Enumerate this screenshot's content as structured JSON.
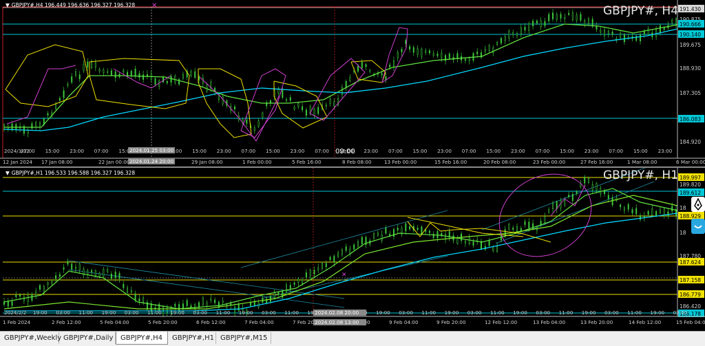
{
  "top_chart": {
    "info": "GBPJPY#,H4  196.449 196.636 196.327 196.328",
    "title": "GBPJPY#, H4",
    "price_labels": [
      {
        "text": "191.430",
        "color": "#d8d8d8",
        "tc": "#000"
      },
      {
        "text": "190.875",
        "color": "none",
        "tc": "#cfcfcf"
      },
      {
        "text": "190.666",
        "color": "#00c8d8",
        "tc": "#000"
      },
      {
        "text": "190.140",
        "color": "#00c8d8",
        "tc": "#000"
      },
      {
        "text": "189.675",
        "color": "none",
        "tc": "#cfcfcf"
      },
      {
        "text": "188.930",
        "color": "none",
        "tc": "#cfcfcf"
      },
      {
        "text": "187.305",
        "color": "none",
        "tc": "#cfcfcf"
      },
      {
        "text": "186.083",
        "color": "#00c8d8",
        "tc": "#000"
      },
      {
        "text": "184.920",
        "color": "none",
        "tc": "#cfcfcf"
      }
    ],
    "time_labels": [
      "12 Jan 2024",
      "17 Jan 08:00",
      "22 Jan 00:00",
      "29 Jan 08:00",
      "1 Feb 00:00",
      "5 Feb 16:00",
      "8 Feb 08:00",
      "13 Feb 00:00",
      "15 Feb 16:00",
      "20 Feb 08:00",
      "23 Feb 00:00",
      "27 Feb 16:00",
      "1 Mar 08:00",
      "6 Mar 00:00"
    ],
    "session_labels": [
      "07:00",
      "15:00",
      "23:00",
      "07:00",
      "15:00",
      "23:00",
      "07:00",
      "15:00",
      "23:00",
      "07:00",
      "15:00",
      "23:00",
      "07:00",
      "15:00",
      "23:00",
      "07:00",
      "15:00",
      "23:00",
      "07:00",
      "15:00",
      "23:00",
      "07:00",
      "15:00",
      "23:00",
      "07:00",
      "15:00",
      "23:00"
    ],
    "chart_start_label": "2024/1/12",
    "crosshair_time_top": "2024.01.25 03:00",
    "crosshair_time_bottom": "2024.01.24 20:00",
    "cursor_time": "09:00"
  },
  "bottom_chart": {
    "info": "GBPJPY#,H1  196.533 196.588 196.327 196.328",
    "title": "GBPJPY#, H1",
    "price_labels": [
      {
        "text": "189.997",
        "color": "#f0e000",
        "tc": "#000"
      },
      {
        "text": "189.820",
        "color": "none",
        "tc": "#cfcfcf"
      },
      {
        "text": "189.612",
        "color": "#00c8d8",
        "tc": "#000"
      },
      {
        "text": "18",
        "color": "none",
        "tc": "#cfcfcf"
      },
      {
        "text": "188.929",
        "color": "#f0e000",
        "tc": "#000"
      },
      {
        "text": "18",
        "color": "none",
        "tc": "#cfcfcf"
      },
      {
        "text": "187.780",
        "color": "none",
        "tc": "#cfcfcf"
      },
      {
        "text": "187.624",
        "color": "#f0e000",
        "tc": "#000"
      },
      {
        "text": "187.158",
        "color": "#f0e000",
        "tc": "#000"
      },
      {
        "text": "186.779",
        "color": "#f0e000",
        "tc": "#000"
      },
      {
        "text": "186.420",
        "color": "none",
        "tc": "#cfcfcf"
      },
      {
        "text": "186.178",
        "color": "#00c8d8",
        "tc": "#000"
      }
    ],
    "time_labels": [
      "1 Feb 2024",
      "2 Feb 12:00",
      "5 Feb 04:00",
      "5 Feb 20:00",
      "6 Feb 12:00",
      "7 Feb 04:00",
      "7 Feb 20:00",
      "8 Feb 12:00",
      "9 Feb 04:00",
      "9 Feb 20:00",
      "12 Feb 12:00",
      "13 Feb 04:00",
      "13 Feb 20:00",
      "14 Feb 12:00",
      "15 Feb 04:00"
    ],
    "session_labels": [
      "19:00",
      "03:00",
      "11:00",
      "19:00",
      "03:00",
      "11:00",
      "19:00",
      "03:00",
      "11:00",
      "19:00",
      "03:00",
      "11:00",
      "19:00",
      "03:00",
      "11:00",
      "19:00",
      "03:00",
      "11:00",
      "19:00",
      "03:00",
      "11:00",
      "19:00",
      "03:00",
      "11:00",
      "19:00",
      "03:00",
      "11:00",
      "19:00",
      "03:00"
    ],
    "chart_start_label": "2024/2/2",
    "crosshair_time_top": "2024.02.08 20:00",
    "crosshair_time_bottom": "2024.02.08 13:00"
  },
  "tabs": [
    {
      "label": "GBPJPY#,Weekly",
      "active": false
    },
    {
      "label": "GBPJPY#,Daily",
      "active": false
    },
    {
      "label": "GBPJPY#,H4",
      "active": true
    },
    {
      "label": "GBPJPY#,H1",
      "active": false
    },
    {
      "label": "GBPJPY#,M15",
      "active": false
    }
  ],
  "colors": {
    "cyan": "#00c8d8",
    "yellow": "#f0e000",
    "magenta": "#d040d0",
    "green": "#60e040",
    "candle": "#3cc83c",
    "sma_cyan": "#00d8ff"
  }
}
